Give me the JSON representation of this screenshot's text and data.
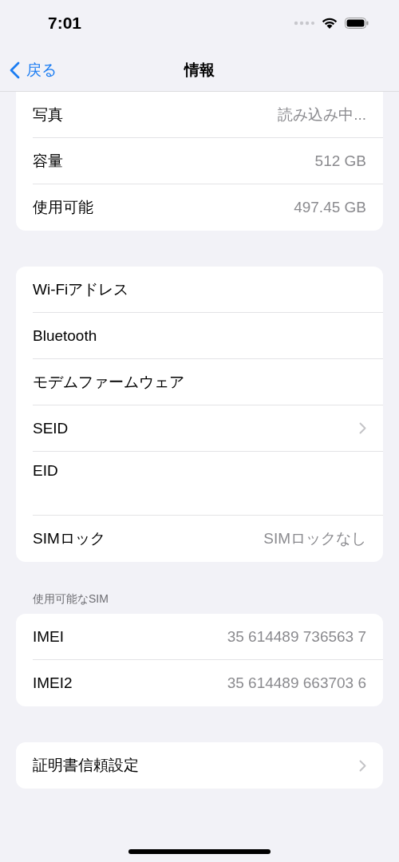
{
  "status_bar": {
    "time": "7:01"
  },
  "nav": {
    "back": "戻る",
    "title": "情報"
  },
  "groups": [
    {
      "rows": [
        {
          "label": "写真",
          "value": "読み込み中...",
          "kind": "value"
        },
        {
          "label": "容量",
          "value": "512 GB",
          "kind": "value"
        },
        {
          "label": "使用可能",
          "value": "497.45 GB",
          "kind": "value"
        }
      ],
      "cut_top": true
    },
    {
      "rows": [
        {
          "label": "Wi-Fiアドレス",
          "kind": "plain"
        },
        {
          "label": "Bluetooth",
          "kind": "plain"
        },
        {
          "label": "モデムファームウェア",
          "kind": "plain"
        },
        {
          "label": "SEID",
          "kind": "chevron"
        },
        {
          "label": "EID",
          "kind": "stacked"
        },
        {
          "label": "SIMロック",
          "value": "SIMロックなし",
          "kind": "value"
        }
      ]
    },
    {
      "header": "使用可能なSIM",
      "rows": [
        {
          "label": "IMEI",
          "value": "35 614489 736563 7",
          "kind": "value"
        },
        {
          "label": "IMEI2",
          "value": "35 614489 663703 6",
          "kind": "value"
        }
      ]
    },
    {
      "rows": [
        {
          "label": "証明書信頼設定",
          "kind": "chevron"
        }
      ]
    }
  ]
}
